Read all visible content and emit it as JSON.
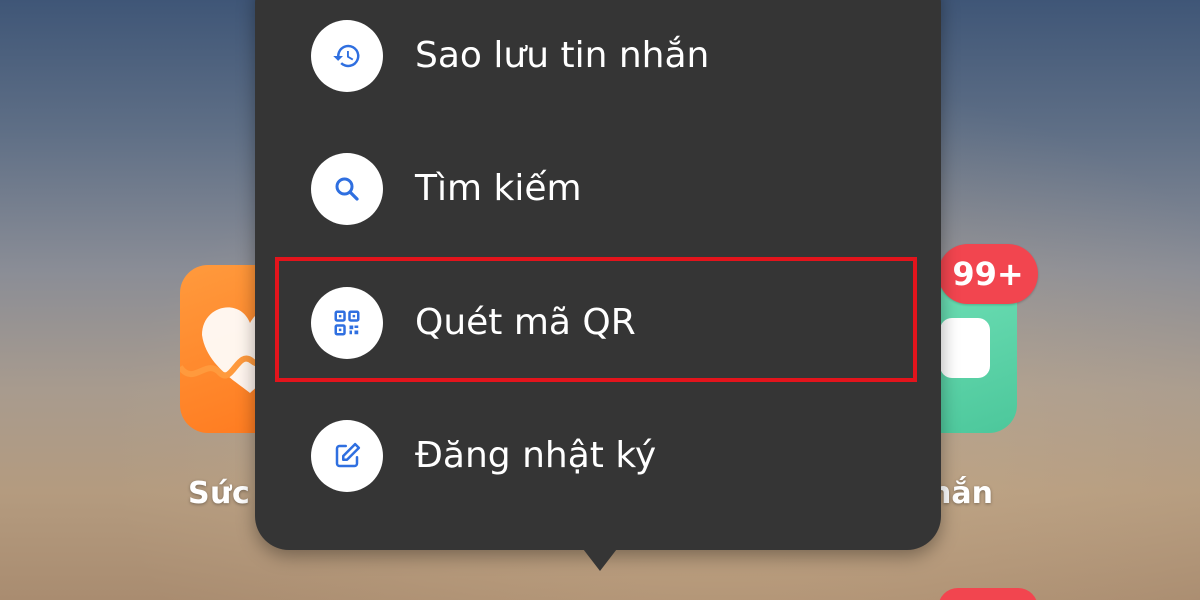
{
  "menu": {
    "items": [
      {
        "label": "Sao lưu tin nhắn",
        "icon": "history-icon"
      },
      {
        "label": "Tìm kiếm",
        "icon": "search-icon"
      },
      {
        "label": "Quét mã QR",
        "icon": "qr-code-icon"
      },
      {
        "label": "Đăng nhật ký",
        "icon": "edit-note-icon"
      }
    ],
    "highlighted_item": "Quét mã QR"
  },
  "home_apps": {
    "left_label": "Sức",
    "right_label": "hắn",
    "right_badge": "99+"
  },
  "colors": {
    "menu_background": "#353535",
    "icon_blue": "#2f6fe0",
    "highlight_red": "#e3141c",
    "badge_red": "#f2454f",
    "health_orange": "#ff7a1f",
    "messages_green": "#4cc79b"
  }
}
